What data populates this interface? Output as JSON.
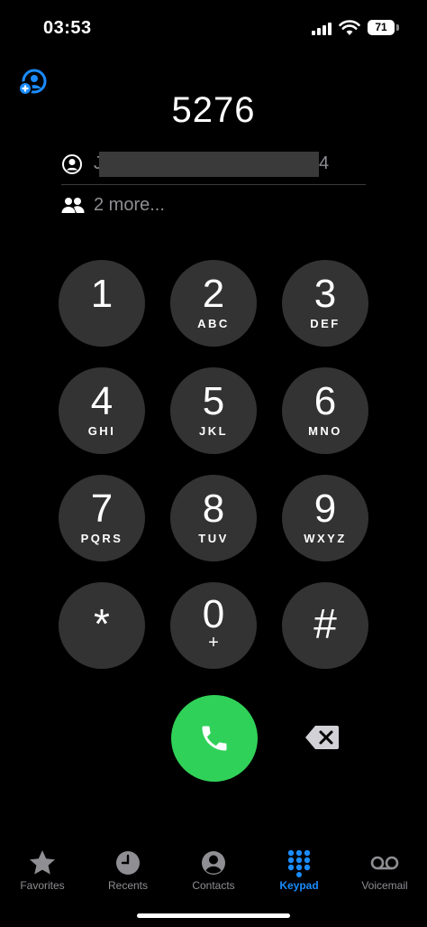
{
  "status_bar": {
    "time": "03:53",
    "battery": "71"
  },
  "dialer": {
    "number": "5276",
    "match_initial": "J",
    "match_tail": "4",
    "more_label": "2 more..."
  },
  "keypad": [
    {
      "digit": "1",
      "letters": ""
    },
    {
      "digit": "2",
      "letters": "ABC"
    },
    {
      "digit": "3",
      "letters": "DEF"
    },
    {
      "digit": "4",
      "letters": "GHI"
    },
    {
      "digit": "5",
      "letters": "JKL"
    },
    {
      "digit": "6",
      "letters": "MNO"
    },
    {
      "digit": "7",
      "letters": "PQRS"
    },
    {
      "digit": "8",
      "letters": "TUV"
    },
    {
      "digit": "9",
      "letters": "WXYZ"
    },
    {
      "digit": "*",
      "letters": ""
    },
    {
      "digit": "0",
      "letters": "+"
    },
    {
      "digit": "#",
      "letters": ""
    }
  ],
  "tabs": [
    {
      "label": "Favorites",
      "icon": "star-icon"
    },
    {
      "label": "Recents",
      "icon": "clock-icon"
    },
    {
      "label": "Contacts",
      "icon": "person-circle-icon"
    },
    {
      "label": "Keypad",
      "icon": "keypad-icon",
      "active": true
    },
    {
      "label": "Voicemail",
      "icon": "voicemail-icon"
    }
  ],
  "colors": {
    "accent": "#1a8cff",
    "call": "#30d158",
    "key": "#333333",
    "secondary_text": "#8e8e93"
  }
}
